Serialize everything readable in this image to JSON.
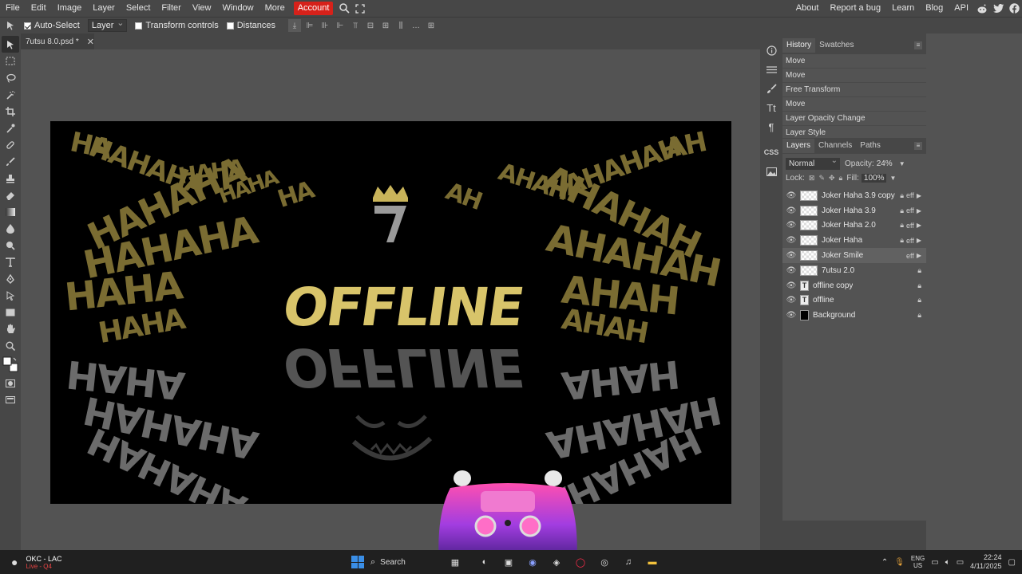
{
  "menu": {
    "items": [
      "File",
      "Edit",
      "Image",
      "Layer",
      "Select",
      "Filter",
      "View",
      "Window",
      "More"
    ],
    "account": "Account",
    "right": [
      "About",
      "Report a bug",
      "Learn",
      "Blog",
      "API"
    ]
  },
  "options": {
    "auto_select": "Auto-Select",
    "auto_select_target": "Layer",
    "transform_controls": "Transform controls",
    "distances": "Distances"
  },
  "document": {
    "tab_title": "7utsu 8.0.psd *"
  },
  "canvas": {
    "main_text": "OFFLINE",
    "haha_words": [
      "HA",
      "HAHA",
      "HAHAHA",
      "AH",
      "AHAH",
      "AHAHAH"
    ],
    "colors": {
      "gold": "#7a6c32",
      "bright_gold": "#d8c46a",
      "grey": "#6b6b6b"
    }
  },
  "history": {
    "tabs": [
      "History",
      "Swatches"
    ],
    "items": [
      "Move",
      "Move",
      "Free Transform",
      "Move",
      "Layer Opacity Change",
      "Layer Style"
    ]
  },
  "layers": {
    "tabs": [
      "Layers",
      "Channels",
      "Paths"
    ],
    "blend_mode": "Normal",
    "opacity_label": "Opacity:",
    "opacity_value": "24%",
    "lock_label": "Lock:",
    "fill_label": "Fill:",
    "fill_value": "100%",
    "fx_label": "eff",
    "items": [
      {
        "name": "Joker Haha 3.9 copy"
      },
      {
        "name": "Joker Haha 3.9"
      },
      {
        "name": "Joker Haha 2.0"
      },
      {
        "name": "Joker Haha"
      },
      {
        "name": "Joker Smile"
      },
      {
        "name": "7utsu 2.0"
      },
      {
        "name": "offline copy"
      },
      {
        "name": "offline"
      },
      {
        "name": "Background"
      }
    ]
  },
  "taskbar": {
    "weather_title": "OKC - LAC",
    "weather_sub": "Live - Q4",
    "search": "Search",
    "lang_top": "ENG",
    "lang_bottom": "US",
    "time": "22:24",
    "date": "4/11/2025"
  }
}
